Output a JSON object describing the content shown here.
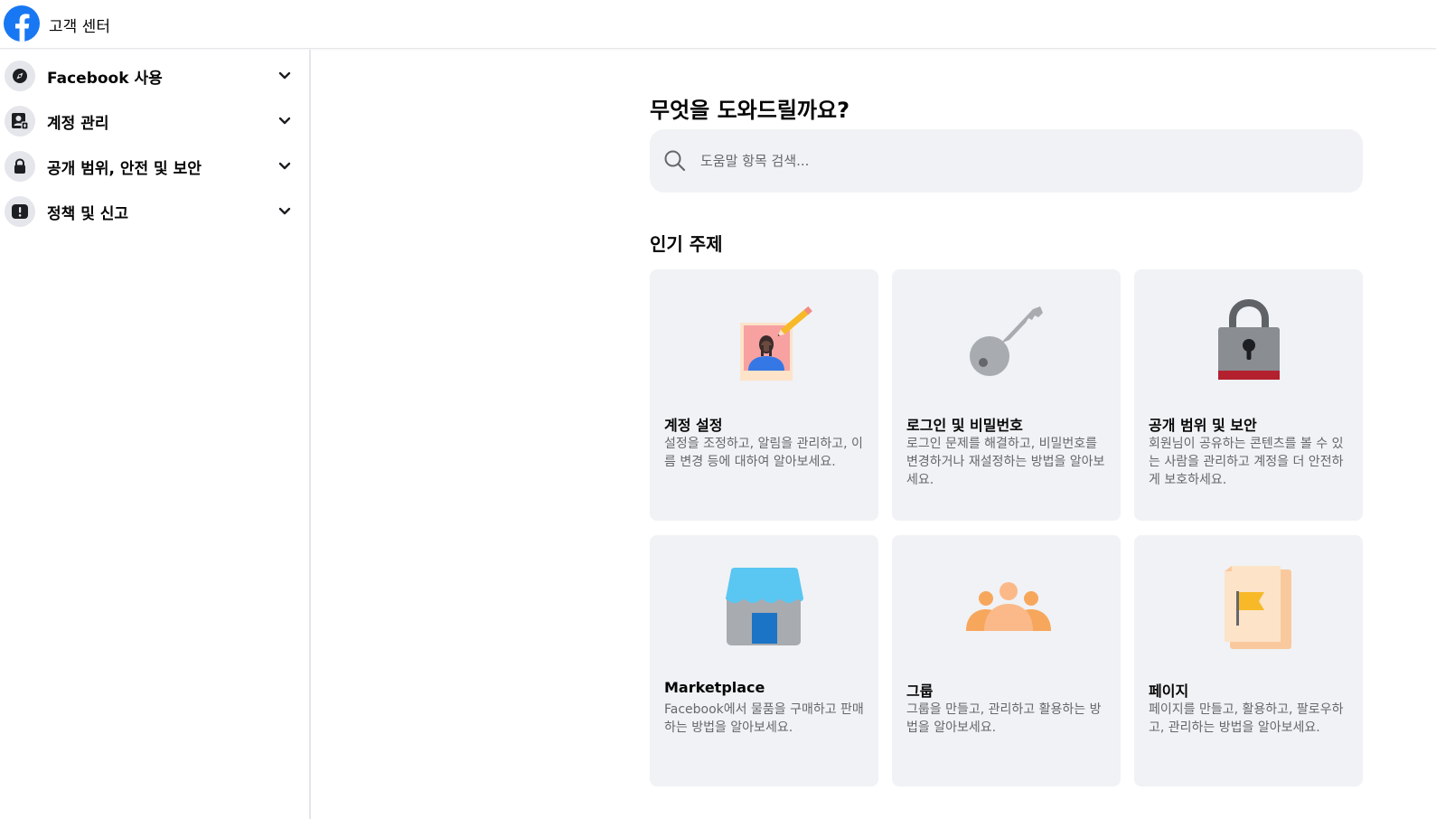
{
  "header": {
    "app_title": "고객 센터",
    "logo_icon": "facebook-logo-icon",
    "brand_color": "#1877F2"
  },
  "sidebar": {
    "items": [
      {
        "label": "Facebook 사용",
        "icon": "compass-icon"
      },
      {
        "label": "계정 관리",
        "icon": "account-card-icon"
      },
      {
        "label": "공개 범위, 안전 및 보안",
        "icon": "lock-icon"
      },
      {
        "label": "정책 및 신고",
        "icon": "alert-icon"
      }
    ]
  },
  "main": {
    "heading": "무엇을 도와드릴까요?",
    "search": {
      "placeholder": "도움말 항목 검색..."
    },
    "section_title": "인기 주제",
    "cards": [
      {
        "title": "계정 설정",
        "description": "설정을 조정하고, 알림을 관리하고, 이름 변경 등에 대하여 알아보세요.",
        "icon": "profile-edit-icon"
      },
      {
        "title": "로그인 및 비밀번호",
        "description": "로그인 문제를 해결하고, 비밀번호를 변경하거나 재설정하는 방법을 알아보세요.",
        "icon": "key-icon"
      },
      {
        "title": "공개 범위 및 보안",
        "description": "회원님이 공유하는 콘텐츠를 볼 수 있는 사람을 관리하고 계정을 더 안전하게 보호하세요.",
        "icon": "padlock-icon"
      },
      {
        "title": "Marketplace",
        "description": "Facebook에서 물품을 구매하고 판매하는 방법을 알아보세요.",
        "icon": "storefront-icon"
      },
      {
        "title": "그룹",
        "description": "그룹을 만들고, 관리하고 활용하는 방법을 알아보세요.",
        "icon": "group-people-icon"
      },
      {
        "title": "페이지",
        "description": "페이지를 만들고, 활용하고, 팔로우하고, 관리하는 방법을 알아보세요.",
        "icon": "page-flag-icon"
      }
    ]
  }
}
